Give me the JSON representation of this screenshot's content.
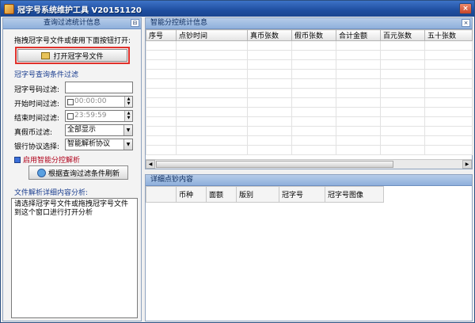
{
  "window": {
    "title": "冠字号系统维护工具 V20151120",
    "buttons": [
      "×"
    ]
  },
  "left_panel": {
    "header": "查询过滤统计信息",
    "pin": "⊟",
    "drag_hint": "拖拽冠字号文件或使用下面按钮打开:",
    "open_button": "打开冠字号文件",
    "filter_section": "冠字号查询条件过滤",
    "filters": {
      "serial_label": "冠字号码过滤:",
      "serial_value": "",
      "start_label": "开始时间过滤:",
      "start_value": "00:00:00",
      "end_label": "结束时间过滤:",
      "end_value": "23:59:59",
      "fake_label": "真假币过滤:",
      "fake_value": "全部显示",
      "protocol_label": "银行协议选择:",
      "protocol_value": "智能解析协议"
    },
    "smart_parse": "启用智能分控解析",
    "refresh_button": "根据查询过滤条件刷新",
    "detail_label": "文件解析详细内容分析:",
    "log_text": "请选择冠字号文件或拖拽冠字号文件到这个窗口进行打开分析"
  },
  "stats_panel": {
    "header": "智能分控统计信息",
    "close": "×",
    "columns": [
      "序号",
      "点钞时间",
      "真币张数",
      "假币张数",
      "合计金额",
      "百元张数",
      "五十张数"
    ],
    "rows": []
  },
  "detail_panel": {
    "header": "详细点钞内容",
    "columns": [
      "",
      "币种",
      "面额",
      "版别",
      "冠字号",
      "冠字号图像"
    ],
    "rows": []
  },
  "colors": {
    "titlebar": "#1f4ea0",
    "panel_header": "#8fb0dc",
    "highlight_border": "#e0312b",
    "selected_cell": "#0a1f8f"
  }
}
